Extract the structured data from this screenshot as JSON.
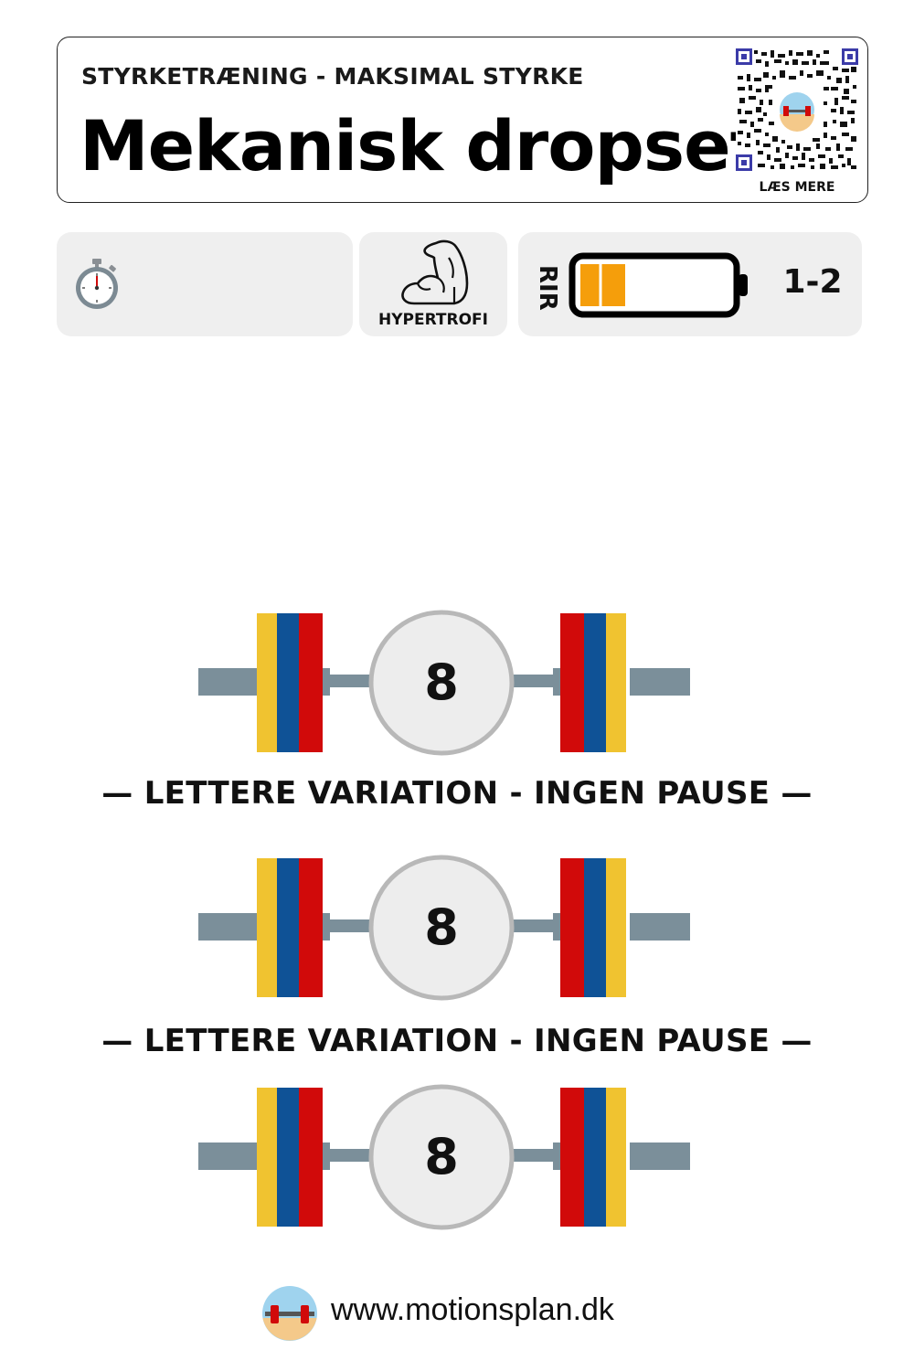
{
  "header": {
    "subtitle": "STYRKETRÆNING - MAKSIMAL STYRKE",
    "title": "Mekanisk dropset",
    "qr_label": "LÆS MERE"
  },
  "info": {
    "timer_icon": "stopwatch-icon",
    "focus_icon": "flexed-arm-icon",
    "focus_label": "HYPERTROFI",
    "rir_label": "RIR",
    "rir_value": "1-2",
    "rir_battery_level": 0.3,
    "battery_fill_color": "#f59e0b"
  },
  "sets": [
    {
      "reps": "8"
    },
    {
      "reps": "8"
    },
    {
      "reps": "8"
    }
  ],
  "dividers": [
    "— LETTERE VARIATION - INGEN PAUSE —",
    "— LETTERE VARIATION - INGEN PAUSE —"
  ],
  "plate_colors": {
    "yellow": "#f0c330",
    "blue": "#0f5296",
    "red": "#d10a0a",
    "bar": "#7b8f9a"
  },
  "footer": {
    "url": "www.motionsplan.dk"
  }
}
